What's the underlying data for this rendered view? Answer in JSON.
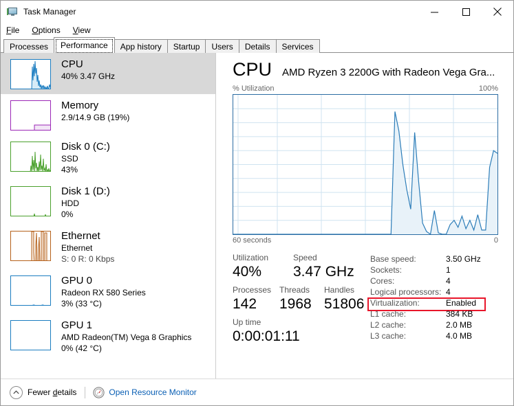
{
  "window": {
    "title": "Task Manager",
    "icon": "task-manager-icon",
    "controls": {
      "minimize": "minimize-icon",
      "maximize": "maximize-icon",
      "close": "close-icon"
    }
  },
  "menu": {
    "items": [
      {
        "label": "File",
        "accel": "F"
      },
      {
        "label": "Options",
        "accel": "O"
      },
      {
        "label": "View",
        "accel": "V"
      }
    ]
  },
  "tabs": {
    "active": "Performance",
    "items": [
      {
        "label": "Processes"
      },
      {
        "label": "Performance"
      },
      {
        "label": "App history"
      },
      {
        "label": "Startup"
      },
      {
        "label": "Users"
      },
      {
        "label": "Details"
      },
      {
        "label": "Services"
      }
    ]
  },
  "sidebar": {
    "items": [
      {
        "title": "CPU",
        "sub1": "40%  3.47 GHz",
        "sub2": "",
        "selected": true,
        "color": "#1a7cc0",
        "fill": "#d7ecf7"
      },
      {
        "title": "Memory",
        "sub1": "2.9/14.9 GB (19%)",
        "sub2": "",
        "selected": false,
        "color": "#9b26b6",
        "fill": "#f2e6f6"
      },
      {
        "title": "Disk 0 (C:)",
        "sub1": "SSD",
        "sub2": "43%",
        "selected": false,
        "color": "#4aa02c",
        "fill": "#e6f3e0"
      },
      {
        "title": "Disk 1 (D:)",
        "sub1": "HDD",
        "sub2": "0%",
        "selected": false,
        "color": "#4aa02c",
        "fill": "#e6f3e0"
      },
      {
        "title": "Ethernet",
        "sub1": "Ethernet",
        "sub2": "S: 0  R: 0 Kbps",
        "selected": false,
        "color": "#b5601a",
        "fill": "#f7e9dd"
      },
      {
        "title": "GPU 0",
        "sub1": "Radeon RX 580 Series",
        "sub2": "3%  (33 °C)",
        "selected": false,
        "color": "#1a7cc0",
        "fill": "#d7ecf7"
      },
      {
        "title": "GPU 1",
        "sub1": "AMD Radeon(TM) Vega 8 Graphics",
        "sub2": "0%  (42 °C)",
        "selected": false,
        "color": "#1a7cc0",
        "fill": "#d7ecf7"
      }
    ]
  },
  "main": {
    "title": "CPU",
    "subtitle": "AMD Ryzen 3 2200G with Radeon Vega Gra...",
    "chart_top_left_label": "% Utilization",
    "chart_top_right_label": "100%",
    "chart_bottom_left_label": "60 seconds",
    "chart_bottom_right_label": "0",
    "stats": {
      "utilization": {
        "label": "Utilization",
        "value": "40%"
      },
      "speed": {
        "label": "Speed",
        "value": "3.47 GHz"
      },
      "processes": {
        "label": "Processes",
        "value": "142"
      },
      "threads": {
        "label": "Threads",
        "value": "1968"
      },
      "handles": {
        "label": "Handles",
        "value": "51806"
      },
      "uptime": {
        "label": "Up time",
        "value": "0:00:01:11"
      }
    },
    "specs": [
      {
        "key": "Base speed:",
        "value": "3.50 GHz",
        "highlighted": false
      },
      {
        "key": "Sockets:",
        "value": "1",
        "highlighted": false
      },
      {
        "key": "Cores:",
        "value": "4",
        "highlighted": false
      },
      {
        "key": "Logical processors:",
        "value": "4",
        "highlighted": false
      },
      {
        "key": "Virtualization:",
        "value": "Enabled",
        "highlighted": true
      },
      {
        "key": "L1 cache:",
        "value": "384 KB",
        "highlighted": false
      },
      {
        "key": "L2 cache:",
        "value": "2.0 MB",
        "highlighted": false
      },
      {
        "key": "L3 cache:",
        "value": "4.0 MB",
        "highlighted": false
      }
    ],
    "highlight_color": "#e8152a"
  },
  "statusbar": {
    "fewer_details": "Fewer details",
    "fewer_details_accel": "d",
    "open_resource_monitor": "Open Resource Monitor",
    "link_color": "#0a5fb4"
  },
  "chart_data": {
    "type": "area",
    "title": "% Utilization",
    "xlabel": "60 seconds",
    "ylabel": "% Utilization",
    "ylim": [
      0,
      100
    ],
    "xlim": [
      60,
      0
    ],
    "grid": true,
    "grid_rows": 10,
    "grid_cols": 6,
    "line_color": "#2b7cb8",
    "fill_color": "#e8f2f9",
    "x": [
      0,
      1,
      2,
      3,
      4,
      5,
      6,
      7,
      8,
      9,
      10,
      11,
      12,
      13,
      14,
      15,
      16,
      17,
      18,
      19,
      20,
      21,
      22,
      23,
      24,
      25,
      26,
      27,
      28,
      29,
      30,
      31,
      32,
      33,
      34,
      35,
      36,
      37,
      38,
      39,
      40,
      41,
      42,
      43,
      44,
      45,
      46,
      47,
      48,
      49,
      50,
      51,
      52,
      53,
      54,
      55,
      56,
      57,
      58,
      59,
      60
    ],
    "values": [
      0,
      0,
      0,
      0,
      0,
      0,
      0,
      0,
      0,
      0,
      0,
      0,
      0,
      0,
      0,
      0,
      0,
      0,
      0,
      0,
      0,
      0,
      0,
      0,
      0,
      0,
      0,
      0,
      0,
      0,
      0,
      0,
      0,
      0,
      0,
      0,
      0,
      0,
      0,
      0,
      0,
      88,
      74,
      50,
      32,
      18,
      73,
      38,
      8,
      2,
      0,
      17,
      1,
      0,
      0,
      7,
      10,
      5,
      13,
      4,
      10,
      3,
      14,
      3,
      3,
      48,
      60,
      58
    ],
    "note": "CPU utilization history over last 60 seconds; flat at 0 for first ~40s then spikes peaking near 88%"
  }
}
